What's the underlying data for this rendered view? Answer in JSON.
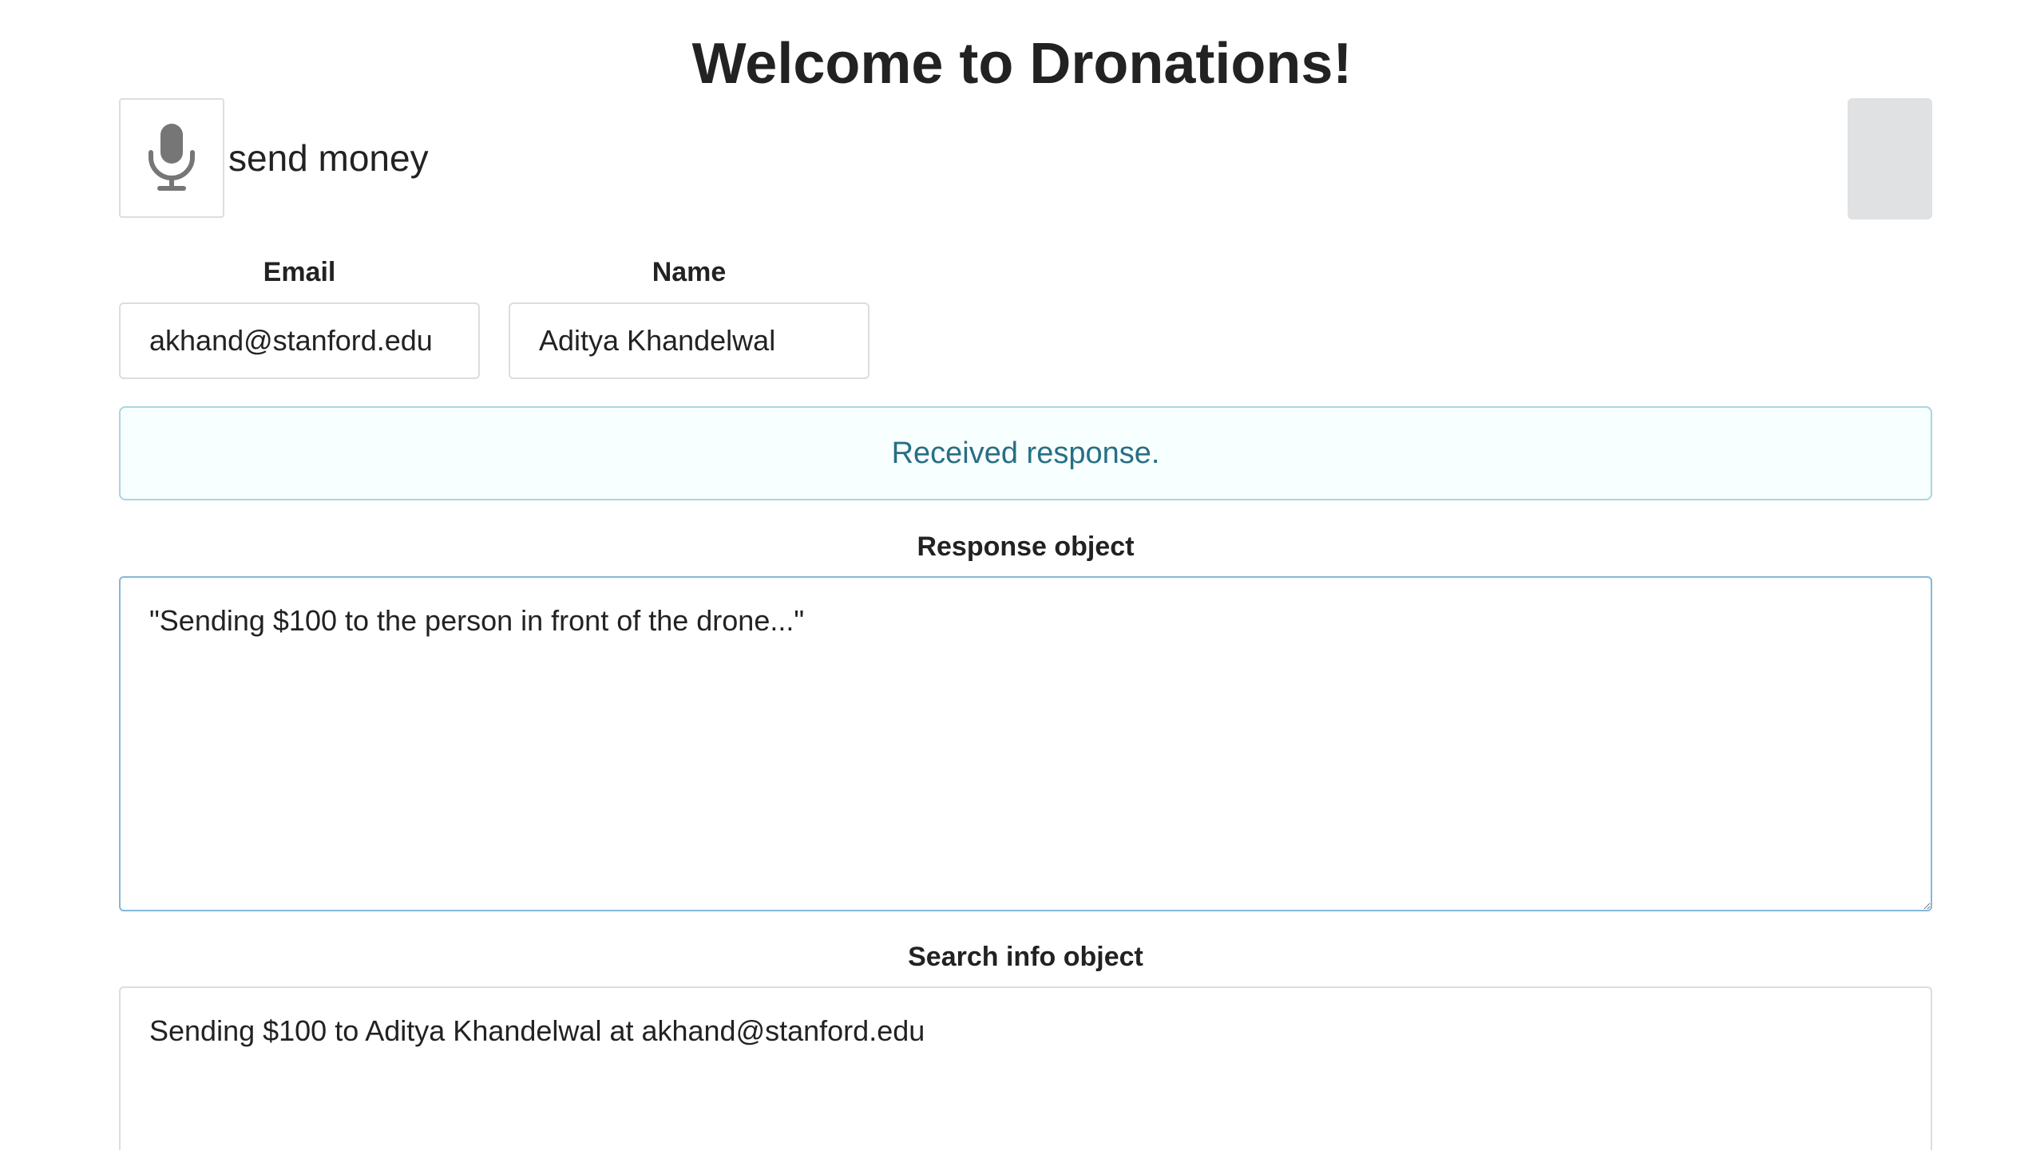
{
  "header": {
    "title": "Welcome to Dronations!"
  },
  "voice": {
    "mic_icon": "microphone-icon",
    "transcript": "send money"
  },
  "form": {
    "email_label": "Email",
    "email_value": "akhand@stanford.edu",
    "name_label": "Name",
    "name_value": "Aditya Khandelwal"
  },
  "status": {
    "message": "Received response."
  },
  "response": {
    "label": "Response object",
    "value": "\"Sending $100 to the person in front of the drone...\""
  },
  "search_info": {
    "label": "Search info object",
    "value": "Sending $100 to Aditya Khandelwal at akhand@stanford.edu"
  },
  "colors": {
    "info_text": "#276f86",
    "info_border": "#a9d5de",
    "info_bg": "#f8ffff",
    "gray_block": "#e0e1e2",
    "mic_icon": "#767676"
  }
}
